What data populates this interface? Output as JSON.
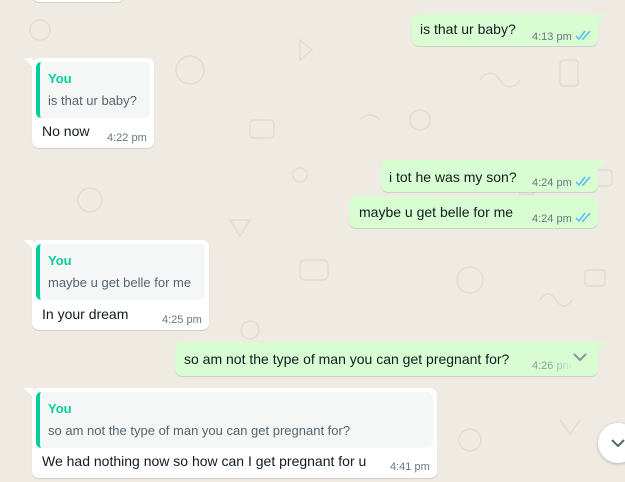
{
  "messages": [
    {
      "dir": "out",
      "text": "is that ur baby?",
      "time": "4:13 pm"
    },
    {
      "dir": "in",
      "quote": {
        "author": "You",
        "text": "is that ur baby?"
      },
      "text": "No now",
      "time": "4:22 pm"
    },
    {
      "dir": "out",
      "text": "i tot he was my son?",
      "time": "4:24 pm"
    },
    {
      "dir": "out",
      "text": "maybe u get belle for me",
      "time": "4:24 pm"
    },
    {
      "dir": "in",
      "quote": {
        "author": "You",
        "text": "maybe u get belle for me"
      },
      "text": "In your dream",
      "time": "4:25 pm"
    },
    {
      "dir": "out",
      "text": "so am not the type of man you can get pregnant for?",
      "time": "4:26 pm"
    },
    {
      "dir": "in",
      "quote": {
        "author": "You",
        "text": "so am not the type of man you can get pregnant for?"
      },
      "text": "We had nothing now so how can I get pregnant for u",
      "time": "4:41 pm"
    }
  ],
  "icons": {
    "read_receipt": "double-check-icon",
    "menu": "chevron-down-icon",
    "scroll": "chevron-down-icon"
  },
  "colors": {
    "background": "#efeae2",
    "outgoing": "#d9fdd3",
    "incoming": "#ffffff",
    "quote_accent": "#06cf9c",
    "read_ticks": "#53bdeb"
  }
}
